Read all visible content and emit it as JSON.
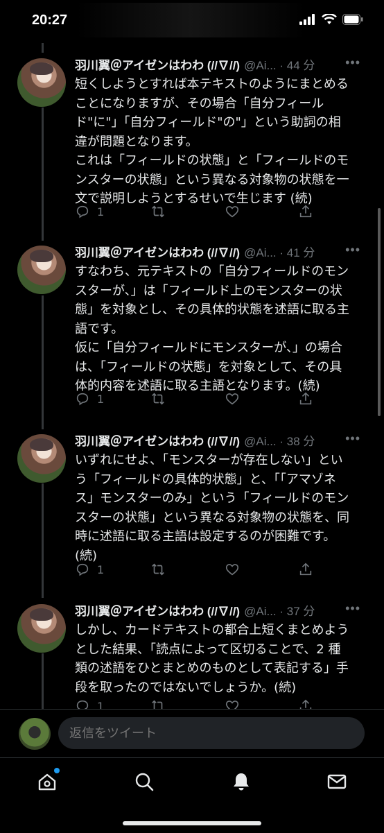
{
  "status_bar": {
    "time": "20:27"
  },
  "tweets": [
    {
      "name": "羽川翼＠アイゼンはわわ (//∇//)",
      "handle": "@Ai...",
      "dot": "·",
      "time": "44 分",
      "text": "短くしようとすれば本テキストのようにまとめる\nことになりますが、その場合「自分フィール\nド\"に\"」「自分フィールド\"の\"」という助詞の相\n違が問題となります。\nこれは「フィールドの状態」と「フィールドのモ\nンスターの状態」という異なる対象物の状態を一\n文で説明しようとするせいで生じます (続)",
      "replies": "1"
    },
    {
      "name": "羽川翼＠アイゼンはわわ (//∇//)",
      "handle": "@Ai...",
      "dot": "·",
      "time": "41 分",
      "text": "すなわち、元テキストの「自分フィールドのモン\nスターが、」は「フィールド上のモンスターの状\n態」を対象とし、その具体的状態を述語に取る主\n語です。\n仮に「自分フィールドにモンスターが、」の場合\nは、「フィールドの状態」を対象として、その具\n体的内容を述語に取る主語となります。(続)",
      "replies": "1"
    },
    {
      "name": "羽川翼＠アイゼンはわわ (//∇//)",
      "handle": "@Ai...",
      "dot": "·",
      "time": "38 分",
      "text": "いずれにせよ、「モンスターが存在しない」とい\nう「フィールドの具体的状態」と、「「アマゾネ\nス」モンスターのみ」という「フィールドのモン\nスターの状態」という異なる対象物の状態を、同\n時に述語に取る主語は設定するのが困難です。\n(続)",
      "replies": "1"
    },
    {
      "name": "羽川翼＠アイゼンはわわ (//∇//)",
      "handle": "@Ai...",
      "dot": "·",
      "time": "37 分",
      "text": "しかし、カードテキストの都合上短くまとめよう\nとした結果、「読点によって区切ることで、2 種\n類の述語をひとまとめのものとして表記する」手\n段を取ったのではないでしょうか。(続)",
      "replies": "1"
    }
  ],
  "compose": {
    "placeholder": "返信をツイート"
  },
  "icons": {
    "reply": "reply-icon",
    "retweet": "retweet-icon",
    "like": "like-icon",
    "share": "share-icon",
    "home": "home-icon",
    "search": "search-icon",
    "notifications": "bell-icon",
    "messages": "mail-icon"
  },
  "colors": {
    "background": "#000000",
    "text": "#e7e9ea",
    "secondary": "#71767b",
    "accent": "#1d9bf0"
  }
}
